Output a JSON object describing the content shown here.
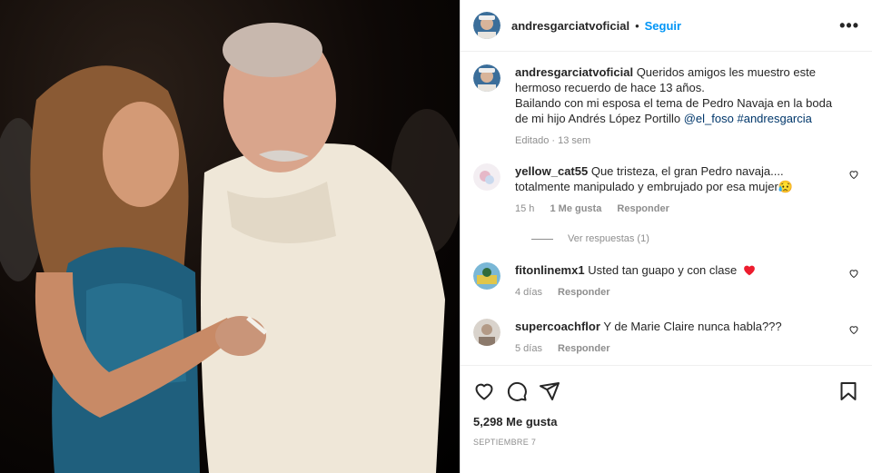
{
  "post": {
    "username": "andresgarciatvoficial",
    "follow_label": "Seguir",
    "more_label": "•••",
    "caption_line1": "Queridos amigos les muestro este hermoso recuerdo de hace 13 años.",
    "caption_line2": "Bailando con mi esposa el tema de Pedro Navaja en la boda de mi hijo Andrés López Portillo",
    "mention": "@el_foso",
    "hashtag": "#andresgarcia",
    "caption_meta": "Editado · 13 sem"
  },
  "comments": [
    {
      "username": "yellow_cat55",
      "text": "Que tristeza, el gran Pedro navaja.... totalmente manipulado y embrujado por esa mujer",
      "emoji": "😥",
      "time": "15 h",
      "likes": "1 Me gusta",
      "reply": "Responder",
      "view_replies": "Ver respuestas (1)"
    },
    {
      "username": "fitonlinemx1",
      "text": "Usted tan guapo y con clase",
      "time": "4 días",
      "reply": "Responder"
    },
    {
      "username": "supercoachflor",
      "text": "Y de Marie Claire nunca habla???",
      "time": "5 días",
      "reply": "Responder"
    }
  ],
  "footer": {
    "likes": "5,298 Me gusta",
    "date": "SEPTIEMBRE 7"
  },
  "colors": {
    "accent": "#0095f6",
    "heart_red": "#ed4956",
    "muted": "#8e8e8e"
  },
  "icons": [
    "heart-icon",
    "comment-icon",
    "share-icon",
    "bookmark-icon",
    "more-icon"
  ]
}
